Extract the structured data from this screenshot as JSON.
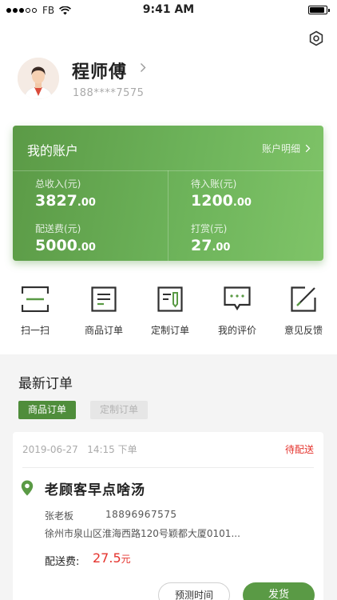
{
  "status_bar": {
    "carrier": "FB",
    "time": "9:41 AM",
    "battery_level": 0.9
  },
  "profile": {
    "name": "程师傅",
    "phone": "188****7575"
  },
  "account": {
    "title": "我的账户",
    "detail_link": "账户明细",
    "stats": [
      {
        "label": "总收入(元)",
        "int": "3827",
        "dec": ".00"
      },
      {
        "label": "待入账(元)",
        "int": "1200",
        "dec": ".00"
      },
      {
        "label": "配送费(元)",
        "int": "5000",
        "dec": ".00"
      },
      {
        "label": "打赏(元)",
        "int": "27",
        "dec": ".00"
      }
    ]
  },
  "actions": [
    {
      "label": "扫一扫",
      "icon": "scan-icon"
    },
    {
      "label": "商品订单",
      "icon": "product-order-icon"
    },
    {
      "label": "定制订单",
      "icon": "custom-order-icon"
    },
    {
      "label": "我的评价",
      "icon": "review-icon"
    },
    {
      "label": "意见反馈",
      "icon": "feedback-icon"
    }
  ],
  "latest_orders": {
    "title": "最新订单",
    "tabs": [
      {
        "label": "商品订单",
        "active": true
      },
      {
        "label": "定制订单",
        "active": false
      }
    ]
  },
  "order": {
    "date": "2019-06-27",
    "time": "14:15",
    "placed_label": "下单",
    "status": "待配送",
    "shop_name": "老顾客早点啥汤",
    "customer_name": "张老板",
    "customer_phone": "18896967575",
    "address": "徐州市泉山区淮海西路120号颖都大厦0101...",
    "fee_label": "配送费:",
    "fee_amount": "27.5",
    "fee_unit": "元",
    "buttons": {
      "estimate": "预测时间",
      "ship": "发货"
    }
  },
  "colors": {
    "brand_green": "#5a9a45",
    "status_red": "#e5332d",
    "card_gradient_start": "#5b9a46",
    "card_gradient_end": "#7fc468"
  }
}
